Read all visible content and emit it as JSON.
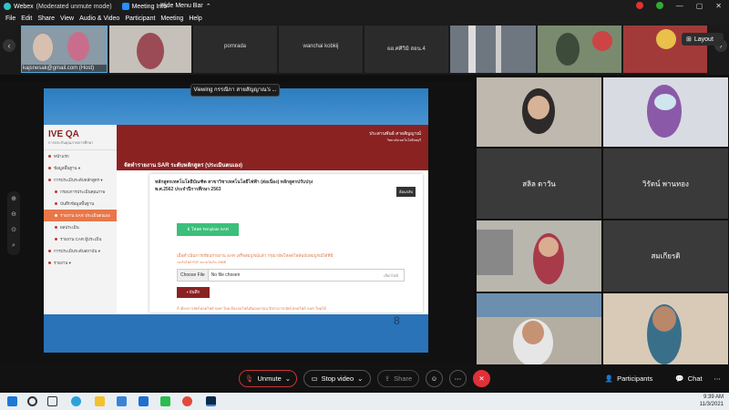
{
  "titlebar": {
    "app": "Webex",
    "mode": "(Moderated unmute mode)",
    "meeting_info": "Meeting Info",
    "hide_menu": "Hide Menu Bar",
    "hide_menu_chevron": "⌃"
  },
  "menubar": [
    "File",
    "Edit",
    "Share",
    "View",
    "Audio & Video",
    "Participant",
    "Meeting",
    "Help"
  ],
  "thumbnails": [
    {
      "name": "kajsnesak@gmail.com (Host)"
    },
    {
      "name": ""
    },
    {
      "name": "pornrada"
    },
    {
      "name": "wanchai kobkij"
    },
    {
      "name": "ผอ.ศศิวิมิ สอน.4"
    },
    {
      "name": ""
    },
    {
      "name": ""
    },
    {
      "name": ""
    }
  ],
  "layout_label": "Layout",
  "viewing_banner": "Viewing กรรณิกา สายสัญญาณ's ...",
  "shared": {
    "brand": "IVE QA",
    "brand_sub": "การประกันคุณภาพการศึกษา",
    "sidebar": [
      {
        "label": "หน้าแรก",
        "sub": false,
        "active": false
      },
      {
        "label": "ข้อมูลพื้นฐาน ▾",
        "sub": false,
        "active": false
      },
      {
        "label": "การประเมินระดับหลักสูตร ▾",
        "sub": false,
        "active": false
      },
      {
        "label": "กรอบการประเมินคุณภาพ",
        "sub": true,
        "active": false
      },
      {
        "label": "บันทึกข้อมูลพื้นฐาน",
        "sub": true,
        "active": false
      },
      {
        "label": "รายงาน SAR ประเมินตนเอง",
        "sub": true,
        "active": true
      },
      {
        "label": "ผลประเมิน",
        "sub": true,
        "active": false
      },
      {
        "label": "รายงาน CAR ผู้ประเมิน",
        "sub": true,
        "active": false
      },
      {
        "label": "การประเมินระดับสถาบัน ▾",
        "sub": false,
        "active": false
      },
      {
        "label": "รายงาน ▾",
        "sub": false,
        "active": false
      }
    ],
    "user_name": "ประสานพันธ์ สายสัญญาณ์",
    "user_sub": "วิทยาลัยเทคโนโลยีลพบุรี",
    "page_title": "จัดทำรายงาน SAR ระดับหลักสูตร (ประเมินตนเอง)",
    "card_title_1": "หลักสูตรเทคโนโลยีบัณฑิต สาขาวิชาเทคโนโลยีไฟฟ้า (ต่อเนื่อง) หลักสูตรปรับปรุง",
    "card_title_2": "พ.ศ.2562  ประจำปีการศึกษา 2563",
    "edit_button": "ย้อนกลับ",
    "download_button": "โหลด Template SAR",
    "warning_1": "เมื่อดำเนินการเขียนรายงาน SAR เสร็จสมบูรณ์แล้ว กรุณาอัพโหลดไฟล์ฉบับสมบูรณ์ได้ที่นี่",
    "warning_2": "รองรับไฟล์ PDF ขนาดไม่เกิน 20MB",
    "choose_file": "Choose File",
    "no_file": "No file chosen",
    "pick_file": "เลือกไฟล์",
    "save_button": "บันทึก",
    "note": "ถ้าต้องการอัพโหลดไฟล์ SAR ใหม่ ต้องลบไฟล์เดิมออกก่อน จึงสามารถอัพโหลดไฟล์ SAR ใหม่ได้",
    "page_number": "8"
  },
  "video_tiles": [
    {
      "name": ""
    },
    {
      "name": ""
    },
    {
      "name": "สลิล ดาวัน"
    },
    {
      "name": "วิรัตน์ พานทอง"
    },
    {
      "name": ""
    },
    {
      "name": "สมเกียรติ"
    },
    {
      "name": ""
    },
    {
      "name": ""
    }
  ],
  "controls": {
    "unmute": "Unmute",
    "stop_video": "Stop video",
    "share": "Share",
    "participants": "Participants",
    "chat": "Chat"
  },
  "clock": {
    "time": "9:39 AM",
    "date": "11/3/2021"
  }
}
